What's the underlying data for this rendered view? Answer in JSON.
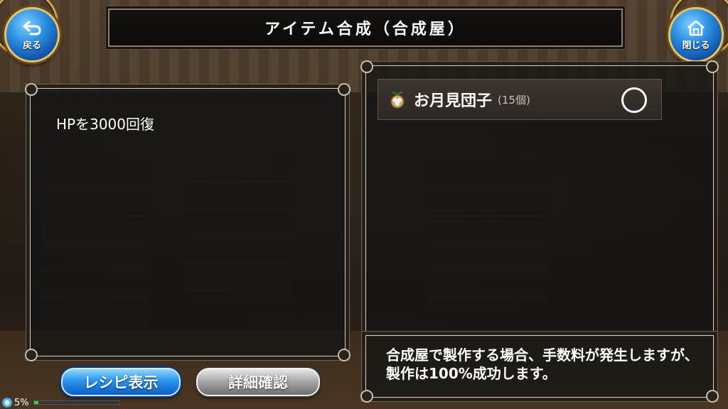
{
  "header": {
    "title": "アイテム合成（合成屋）",
    "back_label": "戻る",
    "close_label": "閉じる"
  },
  "left_panel": {
    "description": "HPを3000回復"
  },
  "right_panel": {
    "item": {
      "name": "お月見団子",
      "count": "(15個)",
      "icon": "dango-icon",
      "status_symbol": "○"
    },
    "note": "合成屋で製作する場合、手数料が発生しますが、製作は100%成功します。"
  },
  "buttons": {
    "recipe_label": "レシピ表示",
    "detail_label": "詳細確認"
  },
  "status_bar": {
    "percent": "5%",
    "progress": 0.05
  },
  "colors": {
    "accent_blue": "#2a8de0",
    "gold_trim": "#e6c46a",
    "disabled_gray": "#a9a9a9"
  }
}
